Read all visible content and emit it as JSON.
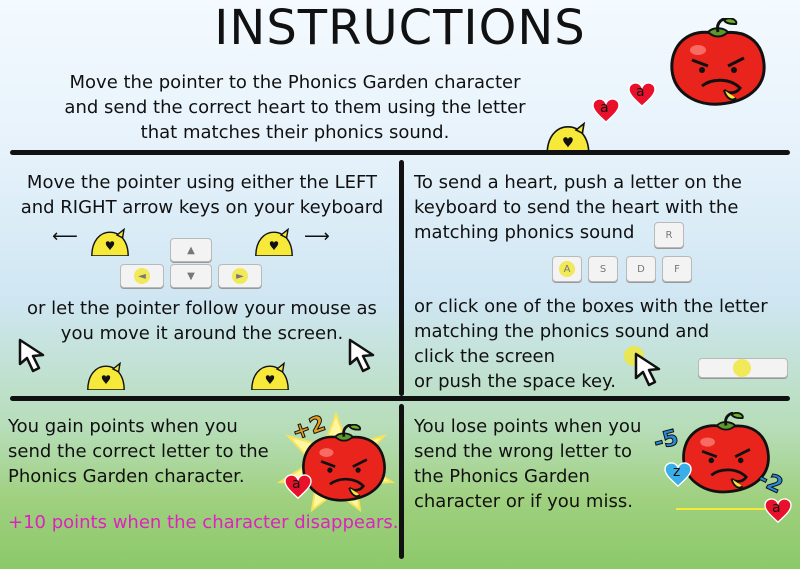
{
  "title": "INSTRUCTIONS",
  "intro": {
    "line1": "Move the pointer to the Phonics Garden character",
    "line2": "and send the correct heart to them using the letter",
    "line3": "that matches their phonics sound.",
    "heart_letters": [
      "a",
      "a"
    ]
  },
  "move_panel": {
    "line1": "Move the pointer using either the LEFT",
    "line2": "and RIGHT arrow keys on your keyboard",
    "line3": "or let the pointer follow your mouse as",
    "line4": "you move it around the screen.",
    "arrow_keys": [
      "▲",
      "◄",
      "▼",
      "►"
    ]
  },
  "send_panel": {
    "line1": "To send a heart, push a letter on the",
    "line2": "keyboard to send the heart with the",
    "line3": "matching phonics sound",
    "keys_top": [
      "R"
    ],
    "keys_row": [
      "A",
      "S",
      "D",
      "F"
    ],
    "line4": "or click one of the boxes with the letter",
    "line5": "matching the phonics sound and",
    "line6": "click the screen",
    "line7": "or push the space key."
  },
  "gain_panel": {
    "line1": "You gain points when you",
    "line2": "send the correct letter to the",
    "line3": "Phonics Garden character.",
    "bonus": "+10 points when the character disappears.",
    "badge": "+2",
    "heart_letter": "a"
  },
  "lose_panel": {
    "line1": "You lose points when you",
    "line2": "send the wrong letter to",
    "line3": "the Phonics Garden",
    "line4": "character or if you miss.",
    "badge1": "-5",
    "badge2": "-2",
    "heart_letter1": "z",
    "heart_letter2": "a"
  },
  "colors": {
    "heart_red": "#e8102a",
    "heart_blue": "#3aaee8",
    "chick_yellow": "#f7e93a",
    "tomato_red": "#e8241c",
    "badge_orange": "#e8a020",
    "badge_blue": "#2a8ad8",
    "bonus_magenta": "#e020c0"
  }
}
